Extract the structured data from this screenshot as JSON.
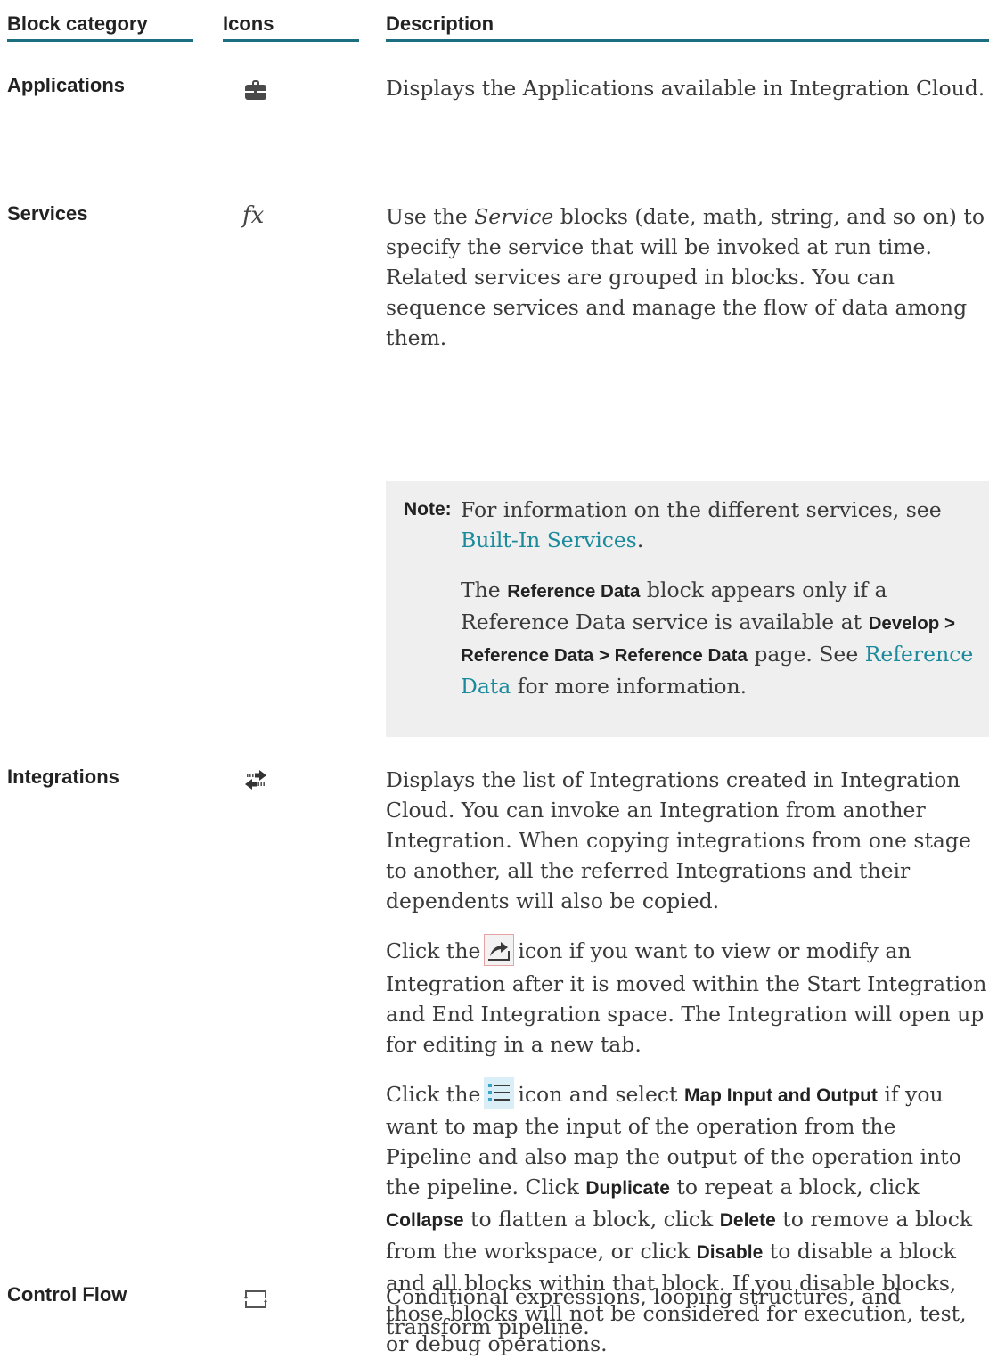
{
  "header": {
    "col1": "Block category",
    "col2": "Icons",
    "col3": "Description"
  },
  "rows": [
    {
      "category": "Applications",
      "icon": "briefcase-icon",
      "description": "Displays the Applications available in Integration Cloud."
    },
    {
      "category": "Services",
      "icon": "fx-function-icon",
      "icon_text": "fx",
      "desc_pre": "Use the ",
      "desc_italic": "Service",
      "desc_post": " blocks (date, math, string, and so on) to specify the service that will be invoked at run time. Related services are grouped in blocks. You can sequence services and manage the flow of data among them.",
      "note": {
        "label": "Note:",
        "p1_pre": "For information on the different services, see ",
        "p1_link": "Built-In Services",
        "p1_post": ".",
        "p2_a": "The ",
        "p2_bold1": "Reference Data",
        "p2_b": " block appears only if a Reference Data service is available at ",
        "p2_bold2": "Develop > Reference Data > Reference Data",
        "p2_c": " page. See ",
        "p2_link": "Reference Data",
        "p2_d": " for more information."
      }
    },
    {
      "category": "Integrations",
      "icon": "exchange-arrows-icon",
      "p1": "Displays the list of Integrations created in Integration Cloud. You can invoke an Integration from another Integration. When copying integrations from one stage to another, all the referred Integrations and their dependents will also be copied.",
      "p2_pre": "Click the",
      "p2_icon": "open-in-new-tab-icon",
      "p2_post": "icon if you want to view or modify an Integration after it is moved within the Start Integration and End Integration space. The Integration will open up for editing in a new tab.",
      "p3_pre": "Click the",
      "p3_icon": "list-menu-icon",
      "p3_mid": "icon and select ",
      "p3_bold1": "Map Input and Output",
      "p3_a": " if you want to map the input of the operation from the Pipeline and also map the output of the operation into the pipeline. Click ",
      "p3_bold2": "Duplicate",
      "p3_b": " to repeat a block, click ",
      "p3_bold3": "Collapse",
      "p3_c": " to flatten a block, click ",
      "p3_bold4": "Delete",
      "p3_d": " to remove a block from the workspace, or click ",
      "p3_bold5": "Disable",
      "p3_e": " to disable a block and all blocks within that block. If you disable blocks, those blocks will not be considered for execution, test, or debug operations."
    },
    {
      "category": "Control Flow",
      "icon": "loop-bracket-icon",
      "description": "Conditional expressions, looping structures, and transform pipeline."
    }
  ],
  "colors": {
    "header_rule": "#1b6f80",
    "link": "#1a8a9c",
    "note_bg": "#efefef"
  }
}
